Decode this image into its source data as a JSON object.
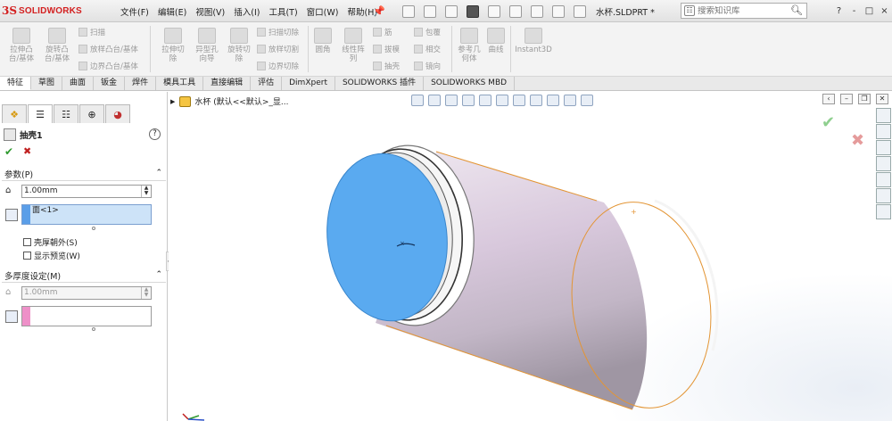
{
  "app": {
    "brand_prefix": "3S",
    "brand": "SOLIDWORKS",
    "document_title": "水杯.SLDPRT *"
  },
  "menu": [
    "文件(F)",
    "编辑(E)",
    "视图(V)",
    "插入(I)",
    "工具(T)",
    "窗口(W)",
    "帮助(H)"
  ],
  "search": {
    "placeholder": "搜索知识库"
  },
  "window_controls": [
    "?",
    "-",
    "□",
    "×"
  ],
  "ribbon": {
    "big": [
      {
        "label": "拉伸凸\n台/基体",
        "icon": "extrude-boss-icon"
      },
      {
        "label": "旋转凸\n台/基体",
        "icon": "revolve-boss-icon"
      },
      {
        "label": "拉伸切\n除",
        "icon": "extrude-cut-icon"
      },
      {
        "label": "异型孔\n向导",
        "icon": "hole-wizard-icon"
      },
      {
        "label": "旋转切\n除",
        "icon": "revolve-cut-icon"
      },
      {
        "label": "圆角",
        "icon": "fillet-icon"
      },
      {
        "label": "线性阵\n列",
        "icon": "linear-pattern-icon"
      },
      {
        "label": "参考几\n何体",
        "icon": "reference-geometry-icon"
      },
      {
        "label": "曲线",
        "icon": "curves-icon"
      },
      {
        "label": "Instant3D",
        "icon": "instant3d-icon"
      }
    ],
    "small": [
      {
        "label": "扫描",
        "icon": "sweep-icon"
      },
      {
        "label": "放样凸台/基体",
        "icon": "loft-icon"
      },
      {
        "label": "边界凸台/基体",
        "icon": "boundary-boss-icon"
      },
      {
        "label": "扫描切除",
        "icon": "swept-cut-icon"
      },
      {
        "label": "放样切割",
        "icon": "lofted-cut-icon"
      },
      {
        "label": "边界切除",
        "icon": "boundary-cut-icon"
      },
      {
        "label": "筋",
        "icon": "rib-icon"
      },
      {
        "label": "拔模",
        "icon": "draft-icon"
      },
      {
        "label": "抽壳",
        "icon": "shell-icon"
      },
      {
        "label": "包覆",
        "icon": "wrap-icon"
      },
      {
        "label": "相交",
        "icon": "intersect-icon"
      },
      {
        "label": "镜向",
        "icon": "mirror-icon"
      }
    ]
  },
  "tabs": [
    "特征",
    "草图",
    "曲面",
    "钣金",
    "焊件",
    "模具工具",
    "直接编辑",
    "评估",
    "DimXpert",
    "SOLIDWORKS 插件",
    "SOLIDWORKS MBD"
  ],
  "active_tab": "特征",
  "tree_path": "水杯  (默认<<默认>_显...",
  "property_manager": {
    "feature_name": "抽壳1",
    "help": "?",
    "ok": "✔",
    "cancel": "✖",
    "params": {
      "title": "参数(P)",
      "thickness": "1.00mm",
      "faces_to_remove": "面<1>",
      "shell_outward": "壳厚朝外(S)",
      "show_preview": "显示预览(W)"
    },
    "multi_thickness": {
      "title": "多厚度设定(M)",
      "thickness": "1.00mm",
      "faces": ""
    }
  },
  "colors": {
    "selected_face": "#5aaaf0",
    "cup_body": "#ded0e2",
    "edge_highlight": "#e39535",
    "ok_green": "#2f9a2f",
    "cancel_red": "#c02020",
    "faces_stripe_blue": "#5a9ee8",
    "faces_stripe_pink": "#ee90c8"
  }
}
